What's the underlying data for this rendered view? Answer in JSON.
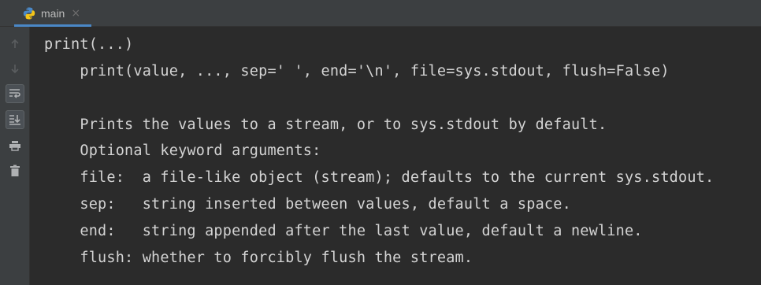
{
  "tab": {
    "label": "main",
    "close": "×",
    "icon": "python-icon"
  },
  "toolbar": {
    "buttons": [
      {
        "icon": "up-arrow-icon",
        "active": false
      },
      {
        "icon": "down-arrow-icon",
        "active": false
      },
      {
        "icon": "soft-wrap-icon",
        "active": true
      },
      {
        "icon": "scroll-to-end-icon",
        "active": true
      },
      {
        "icon": "print-icon",
        "active": false
      },
      {
        "icon": "trash-icon",
        "active": false
      }
    ]
  },
  "colors": {
    "background": "#2b2b2b",
    "panel": "#3c3f41",
    "text": "#d4d4d4",
    "tab_underline": "#4a88c7"
  },
  "console": {
    "lines": [
      "print(...)",
      "    print(value, ..., sep=' ', end='\\n', file=sys.stdout, flush=False)",
      "",
      "    Prints the values to a stream, or to sys.stdout by default.",
      "    Optional keyword arguments:",
      "    file:  a file-like object (stream); defaults to the current sys.stdout.",
      "    sep:   string inserted between values, default a space.",
      "    end:   string appended after the last value, default a newline.",
      "    flush: whether to forcibly flush the stream."
    ]
  }
}
